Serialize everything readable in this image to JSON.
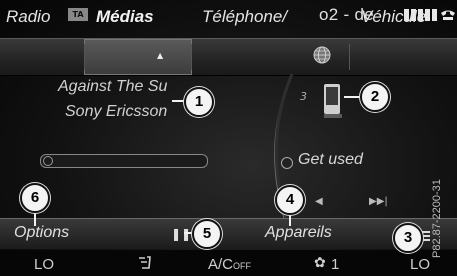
{
  "status": {
    "ta_label": "TA",
    "carrier": "o2 - de",
    "signal_bars": 5,
    "phone_icon": "phone-handset-icon"
  },
  "menu": {
    "items": [
      {
        "label": "Radio",
        "active": false
      },
      {
        "label": "Médias",
        "active": true
      },
      {
        "label": "Téléphone/",
        "active": false
      },
      {
        "label": "Véhicule",
        "active": false
      }
    ],
    "active_marker": "▲",
    "globe_icon": "globe-icon"
  },
  "media": {
    "title": "Against The Su",
    "artist": "Sony Ericsson",
    "track_number": "3",
    "device_icon": "mobile-phone-icon",
    "progress": 0.0,
    "up_next": "Get used"
  },
  "playback": {
    "prev_glyph": "◀",
    "next_glyph": "▶▶|",
    "pause_glyph": "❚❚"
  },
  "functions": {
    "options": "Options",
    "devices": "Appareils",
    "menu_icon": "list-icon"
  },
  "climate": {
    "left_temp": "LO",
    "airflow_icon": "seat-airflow-icon",
    "ac_label": "A/C",
    "ac_sub": "OFF",
    "fan_icon": "fan-icon",
    "fan_level": "1",
    "right_temp": "LO"
  },
  "callouts": [
    "1",
    "2",
    "3",
    "4",
    "5",
    "6"
  ],
  "side_code": "P82.87-2200-31",
  "colors": {
    "background": "#0a0a0a",
    "text": "#d8d8d8",
    "callout_bg": "#f4f4f4"
  }
}
